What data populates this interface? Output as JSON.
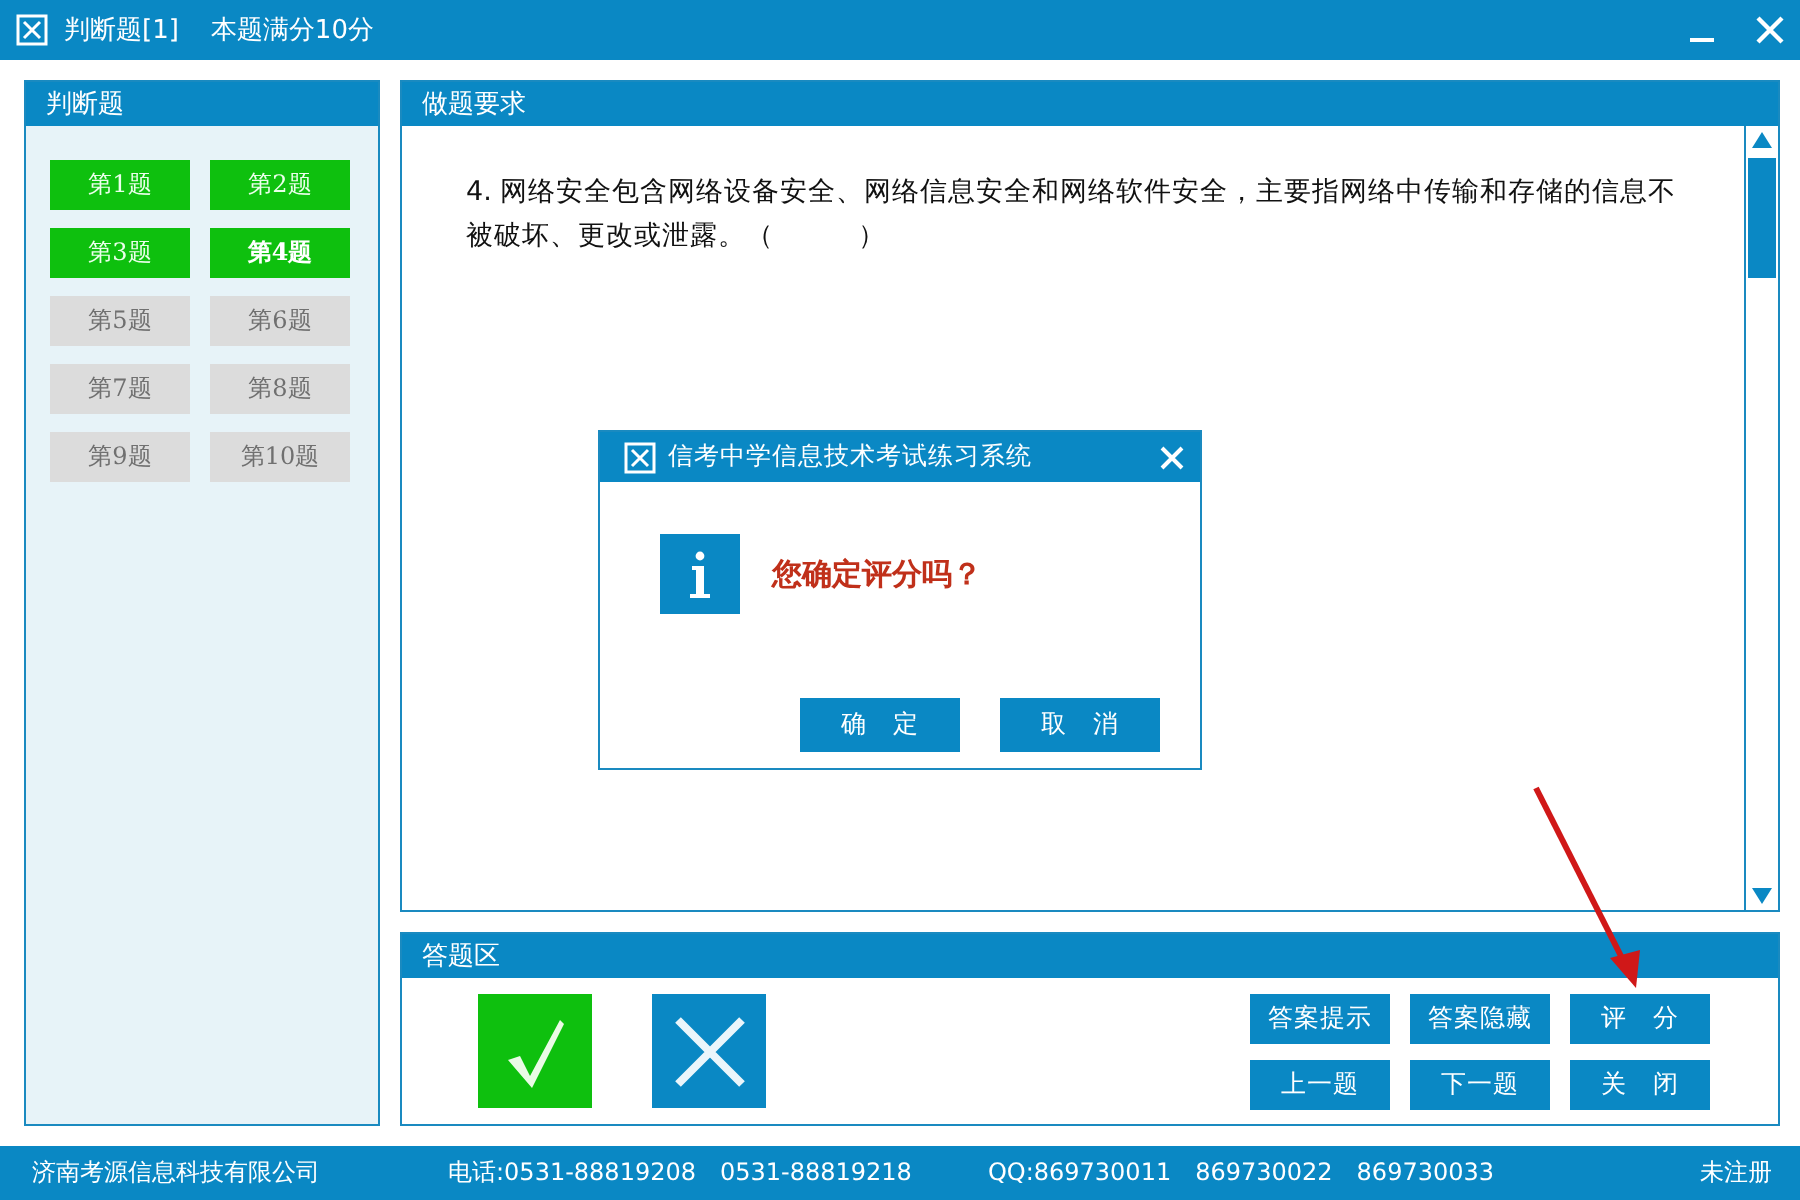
{
  "window": {
    "title": "判断题[1]",
    "subtitle": "本题满分10分"
  },
  "question_list": {
    "title": "判断题",
    "items": [
      {
        "label": "第1题",
        "answered": true,
        "selected": false
      },
      {
        "label": "第2题",
        "answered": true,
        "selected": false
      },
      {
        "label": "第3题",
        "answered": true,
        "selected": false
      },
      {
        "label": "第4题",
        "answered": true,
        "selected": true
      },
      {
        "label": "第5题",
        "answered": false,
        "selected": false
      },
      {
        "label": "第6题",
        "answered": false,
        "selected": false
      },
      {
        "label": "第7题",
        "answered": false,
        "selected": false
      },
      {
        "label": "第8题",
        "answered": false,
        "selected": false
      },
      {
        "label": "第9题",
        "answered": false,
        "selected": false
      },
      {
        "label": "第10题",
        "answered": false,
        "selected": false
      }
    ]
  },
  "question_panel": {
    "title": "做题要求",
    "text": "4. 网络安全包含网络设备安全、网络信息安全和网络软件安全，主要指网络中传输和存储的信息不被破坏、更改或泄露。（　　　）"
  },
  "answer_panel": {
    "title": "答题区",
    "answers": [
      {
        "kind": "true",
        "selected": true
      },
      {
        "kind": "false",
        "selected": false
      }
    ],
    "buttons": [
      "答案提示",
      "答案隐藏",
      "评　分",
      "上一题",
      "下一题",
      "关　闭"
    ]
  },
  "dialog": {
    "title": "信考中学信息技术考试练习系统",
    "message": "您确定评分吗？",
    "buttons": [
      "确　定",
      "取　消"
    ]
  },
  "status_bar": {
    "company": "济南考源信息科技有限公司",
    "phone": "电话:0531-88819208　0531-88819218",
    "qq": "QQ:869730011　869730022　869730033",
    "registration": "未注册"
  }
}
